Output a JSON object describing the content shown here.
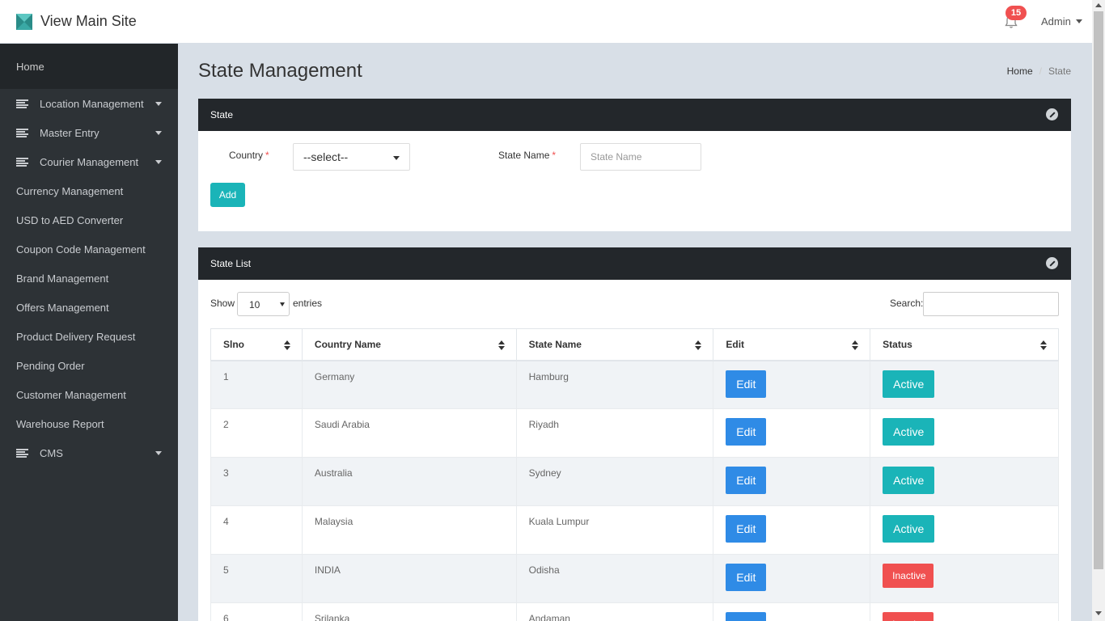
{
  "header": {
    "brand_text": "View Main Site",
    "notification_count": "15",
    "user_label": "Admin"
  },
  "sidebar": {
    "home": "Home",
    "items": [
      {
        "label": "Location Management",
        "icon": "list-lines-icon",
        "has_submenu": true
      },
      {
        "label": "Master Entry",
        "icon": "list-lines-icon",
        "has_submenu": true
      },
      {
        "label": "Courier Management",
        "icon": "list-lines-icon",
        "has_submenu": true
      },
      {
        "label": "Currency Management",
        "icon": "",
        "has_submenu": false
      },
      {
        "label": "USD to AED Converter",
        "icon": "",
        "has_submenu": false
      },
      {
        "label": "Coupon Code Management",
        "icon": "",
        "has_submenu": false
      },
      {
        "label": "Brand Management",
        "icon": "",
        "has_submenu": false
      },
      {
        "label": "Offers Management",
        "icon": "",
        "has_submenu": false
      },
      {
        "label": "Product Delivery Request",
        "icon": "",
        "has_submenu": false
      },
      {
        "label": "Pending Order",
        "icon": "",
        "has_submenu": false
      },
      {
        "label": "Customer Management",
        "icon": "",
        "has_submenu": false
      },
      {
        "label": "Warehouse Report",
        "icon": "",
        "has_submenu": false
      },
      {
        "label": "CMS",
        "icon": "list-lines-icon",
        "has_submenu": true
      }
    ]
  },
  "page": {
    "title": "State Management",
    "breadcrumb": [
      "Home",
      "State"
    ]
  },
  "form_panel": {
    "heading": "State",
    "country_label": "Country",
    "country_value": "--select--",
    "state_label": "State Name",
    "state_placeholder": "State Name",
    "required_mark": "*",
    "add_label": "Add"
  },
  "list_panel": {
    "heading": "State List",
    "show_label": "Show",
    "entries_value": "10",
    "entries_label": "entries",
    "search_label": "Search:",
    "columns": [
      "Slno",
      "Country Name",
      "State Name",
      "Edit",
      "Status"
    ],
    "rows": [
      {
        "slno": "1",
        "country": "Germany",
        "state": "Hamburg",
        "edit": "Edit",
        "status": "Active"
      },
      {
        "slno": "2",
        "country": "Saudi Arabia",
        "state": "Riyadh",
        "edit": "Edit",
        "status": "Active"
      },
      {
        "slno": "3",
        "country": "Australia",
        "state": "Sydney",
        "edit": "Edit",
        "status": "Active"
      },
      {
        "slno": "4",
        "country": "Malaysia",
        "state": "Kuala Lumpur",
        "edit": "Edit",
        "status": "Active"
      },
      {
        "slno": "5",
        "country": "INDIA",
        "state": "Odisha",
        "edit": "Edit",
        "status": "Inactive"
      },
      {
        "slno": "6",
        "country": "Srilanka",
        "state": "Andaman",
        "edit": "Edit",
        "status": "Inactive"
      }
    ]
  },
  "colors": {
    "sidebar_bg": "#2d3236",
    "panel_head_bg": "#23272b",
    "teal": "#1ab4b8",
    "blue": "#2f8be6",
    "red": "#f05050"
  }
}
